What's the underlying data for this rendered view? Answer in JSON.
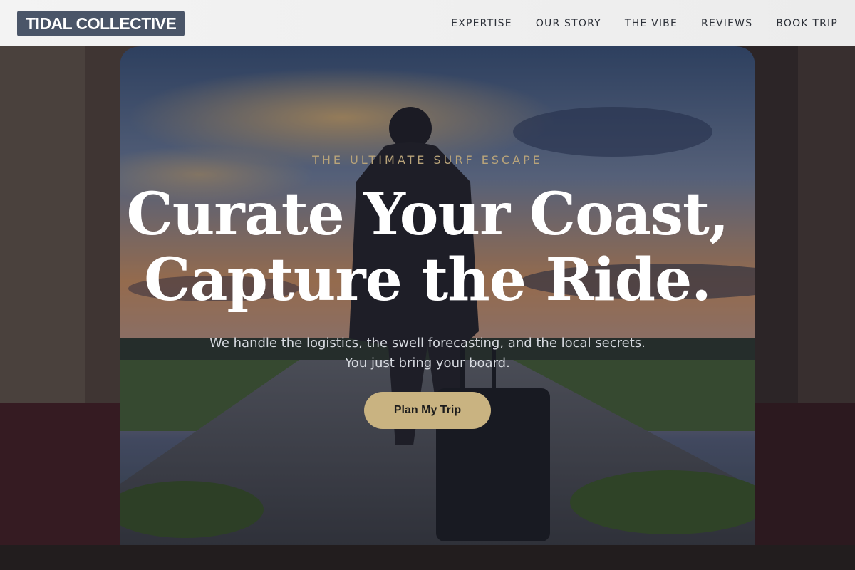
{
  "header": {
    "logo": "TIDAL COLLECTIVE",
    "nav": [
      "EXPERTISE",
      "OUR STORY",
      "THE VIBE",
      "REVIEWS",
      "BOOK TRIP"
    ]
  },
  "hero": {
    "eyebrow": "THE ULTIMATE SURF ESCAPE",
    "headline_line1": "Curate Your Coast,",
    "headline_line2": "Capture the Ride.",
    "subtext_line1": "We handle the logistics, the swell forecasting, and the local secrets.",
    "subtext_line2": "You just bring your board.",
    "cta_label": "Plan My Trip"
  },
  "colors": {
    "accent_gold": "#c9b381",
    "eyebrow_gold": "#b9a47a",
    "logo_bg": "#4a5568",
    "header_bg": "#f1f1f1"
  }
}
